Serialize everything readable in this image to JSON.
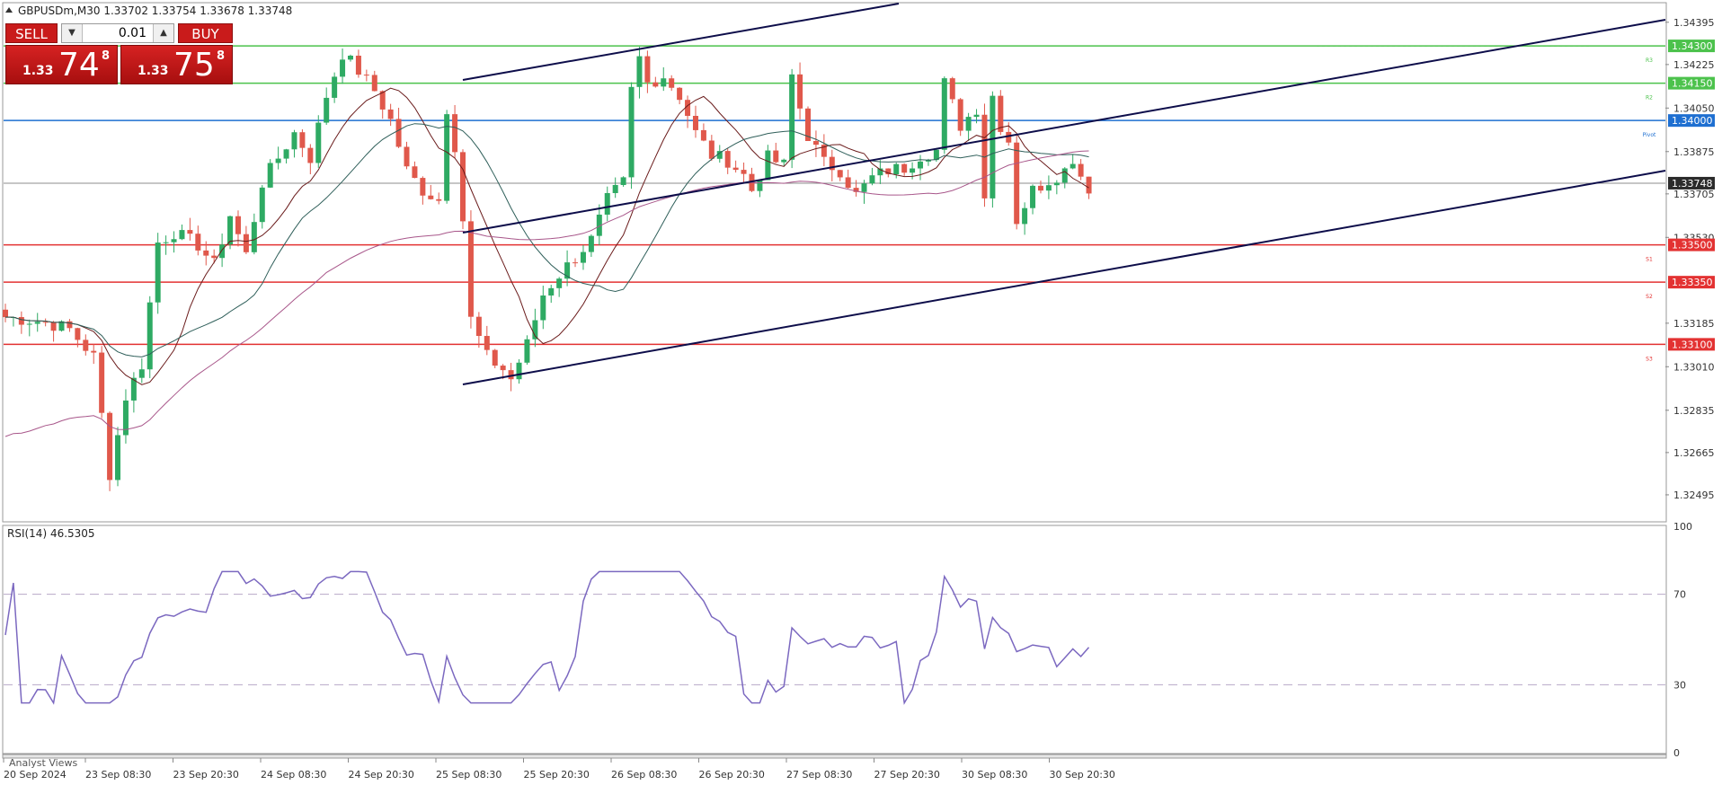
{
  "header": {
    "symbol_line": "GBPUSDm,M30  1.33702 1.33754 1.33678 1.33748"
  },
  "trade_panel": {
    "sell_label": "SELL",
    "buy_label": "BUY",
    "volume": "0.01",
    "sell_price_small": "1.33",
    "sell_price_big": "74",
    "sell_price_sup": "8",
    "buy_price_small": "1.33",
    "buy_price_big": "75",
    "buy_price_sup": "8"
  },
  "price_axis": {
    "ticks": [
      "1.34395",
      "1.34225",
      "1.34050",
      "1.33875",
      "1.33705",
      "1.33530",
      "1.33185",
      "1.33010",
      "1.32835",
      "1.32665",
      "1.32495"
    ],
    "range": [
      1.3239,
      1.3447
    ]
  },
  "levels": [
    {
      "label": "1.34300",
      "value": 1.343,
      "tag": "R3",
      "color": "#4cc24c"
    },
    {
      "label": "1.34150",
      "value": 1.3415,
      "tag": "R2",
      "color": "#4cc24c"
    },
    {
      "label": "1.34000",
      "value": 1.34,
      "tag": "Pivot",
      "color": "#1e6fd1"
    },
    {
      "label": "1.33500",
      "value": 1.335,
      "tag": "S1",
      "color": "#e33232"
    },
    {
      "label": "1.33350",
      "value": 1.3335,
      "tag": "S2",
      "color": "#e33232"
    },
    {
      "label": "1.33100",
      "value": 1.331,
      "tag": "S3",
      "color": "#e33232"
    }
  ],
  "current_price": {
    "label": "1.33748",
    "value": 1.33748,
    "color": "#2b2b2b"
  },
  "rsi": {
    "title": "RSI(14) 46.5305",
    "axis": [
      "100",
      "70",
      "30",
      "0"
    ],
    "levels": [
      70,
      30
    ],
    "color": "#7b68c0"
  },
  "time_axis": {
    "labels": [
      "20 Sep 2024",
      "23 Sep 08:30",
      "23 Sep 20:30",
      "24 Sep 08:30",
      "24 Sep 20:30",
      "25 Sep 08:30",
      "25 Sep 20:30",
      "26 Sep 08:30",
      "26 Sep 20:30",
      "27 Sep 08:30",
      "27 Sep 20:30",
      "30 Sep 08:30",
      "30 Sep 20:30"
    ]
  },
  "footer": {
    "analyst_views": "Analyst Views"
  },
  "colors": {
    "bull_candle": "#2eaa63",
    "bear_candle": "#e0584b",
    "trend_line": "#0d0d4a",
    "ma_fast": "#6a1b1b",
    "ma_mid": "#2f5f5a",
    "ma_slow": "#a8568a"
  },
  "chart_data": {
    "type": "candlestick",
    "symbol": "GBPUSDm",
    "timeframe": "M30",
    "close_path": [
      [
        0,
        1.3321
      ],
      [
        5,
        1.3319
      ],
      [
        8,
        1.3316
      ],
      [
        11,
        1.3305
      ],
      [
        13,
        1.3258
      ],
      [
        15,
        1.3289
      ],
      [
        17,
        1.3302
      ],
      [
        19,
        1.3351
      ],
      [
        21,
        1.3355
      ],
      [
        24,
        1.335
      ],
      [
        26,
        1.3342
      ],
      [
        28,
        1.3362
      ],
      [
        30,
        1.3346
      ],
      [
        32,
        1.3375
      ],
      [
        34,
        1.3385
      ],
      [
        36,
        1.3395
      ],
      [
        38,
        1.3385
      ],
      [
        40,
        1.341
      ],
      [
        42,
        1.3427
      ],
      [
        44,
        1.342
      ],
      [
        46,
        1.3412
      ],
      [
        48,
        1.34
      ],
      [
        50,
        1.338
      ],
      [
        52,
        1.3372
      ],
      [
        54,
        1.3368
      ],
      [
        55,
        1.3405
      ],
      [
        56,
        1.339
      ],
      [
        57,
        1.336
      ],
      [
        58,
        1.332
      ],
      [
        60,
        1.3305
      ],
      [
        62,
        1.33
      ],
      [
        63,
        1.3296
      ],
      [
        65,
        1.331
      ],
      [
        67,
        1.333
      ],
      [
        69,
        1.3338
      ],
      [
        71,
        1.3345
      ],
      [
        73,
        1.3352
      ],
      [
        75,
        1.3368
      ],
      [
        77,
        1.3375
      ],
      [
        78,
        1.3412
      ],
      [
        79,
        1.3425
      ],
      [
        80,
        1.3415
      ],
      [
        82,
        1.3418
      ],
      [
        84,
        1.341
      ],
      [
        86,
        1.3395
      ],
      [
        88,
        1.3386
      ],
      [
        90,
        1.3384
      ],
      [
        92,
        1.3378
      ],
      [
        93,
        1.3372
      ],
      [
        95,
        1.3385
      ],
      [
        97,
        1.3382
      ],
      [
        98,
        1.3418
      ],
      [
        99,
        1.3405
      ],
      [
        100,
        1.3394
      ],
      [
        102,
        1.3383
      ],
      [
        104,
        1.338
      ],
      [
        106,
        1.337
      ],
      [
        108,
        1.3377
      ],
      [
        110,
        1.338
      ],
      [
        112,
        1.3381
      ],
      [
        114,
        1.3386
      ],
      [
        116,
        1.3388
      ],
      [
        117,
        1.3415
      ],
      [
        119,
        1.3398
      ],
      [
        121,
        1.3405
      ],
      [
        122,
        1.337
      ],
      [
        123,
        1.341
      ],
      [
        124,
        1.3398
      ],
      [
        125,
        1.3392
      ],
      [
        126,
        1.336
      ],
      [
        128,
        1.3372
      ],
      [
        130,
        1.3376
      ],
      [
        132,
        1.338
      ],
      [
        133,
        1.3385
      ],
      [
        134,
        1.3378
      ],
      [
        135,
        1.3373
      ]
    ],
    "last_index": 135
  }
}
